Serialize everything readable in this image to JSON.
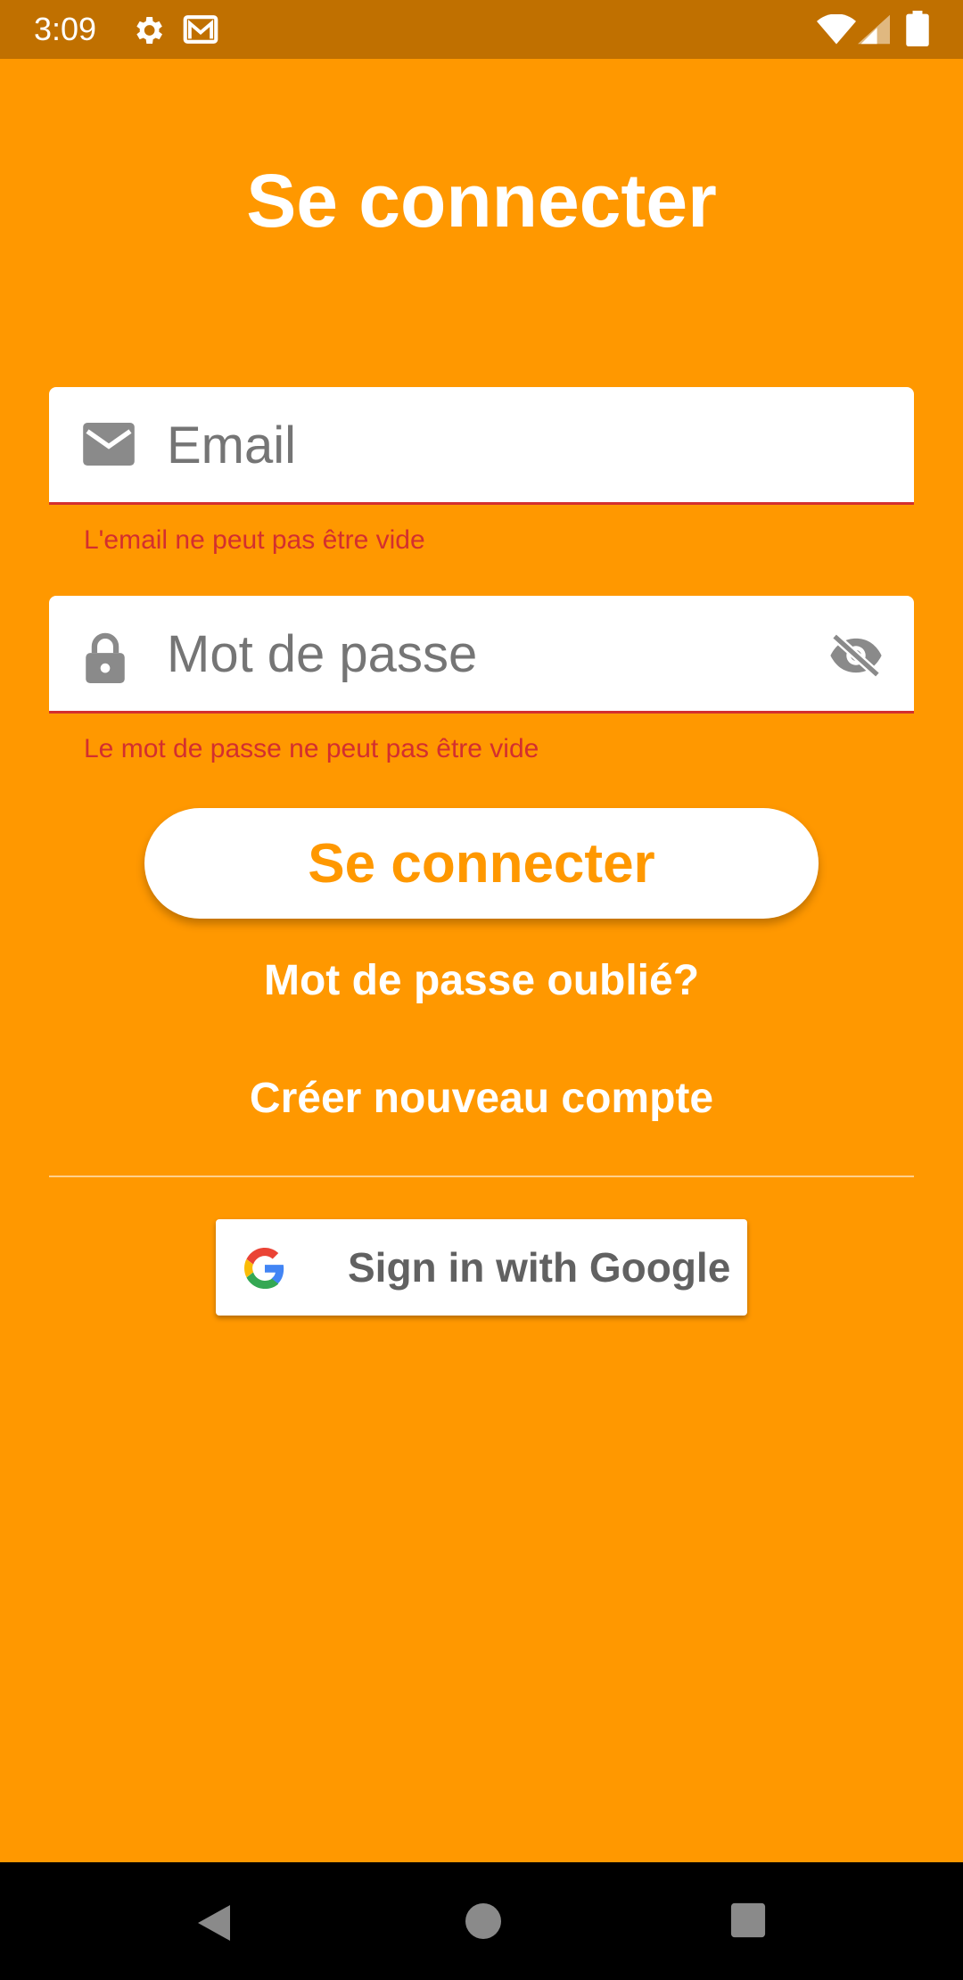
{
  "status_bar": {
    "time": "3:09",
    "icons": [
      "gear-icon",
      "mail-icon",
      "wifi-icon",
      "signal-icon",
      "battery-icon"
    ]
  },
  "login": {
    "title": "Se connecter",
    "email": {
      "placeholder": "Email",
      "error": "L'email ne peut pas être vide",
      "icon": "email-icon"
    },
    "password": {
      "placeholder": "Mot de passe",
      "error": "Le mot de passe ne peut pas être vide",
      "icon": "lock-icon",
      "toggle_icon": "visibility-off-icon"
    },
    "submit_label": "Se connecter",
    "forgot_password": "Mot de passe oublié?",
    "create_account": "Créer nouveau compte",
    "google_label": "Sign in with Google"
  },
  "nav_bar": {
    "buttons": [
      "back-icon",
      "home-icon",
      "recents-icon"
    ]
  },
  "colors": {
    "background": "#FF9800",
    "status_bar": "#C07000",
    "error": "#D32F2F",
    "surface": "#FFFFFF"
  }
}
